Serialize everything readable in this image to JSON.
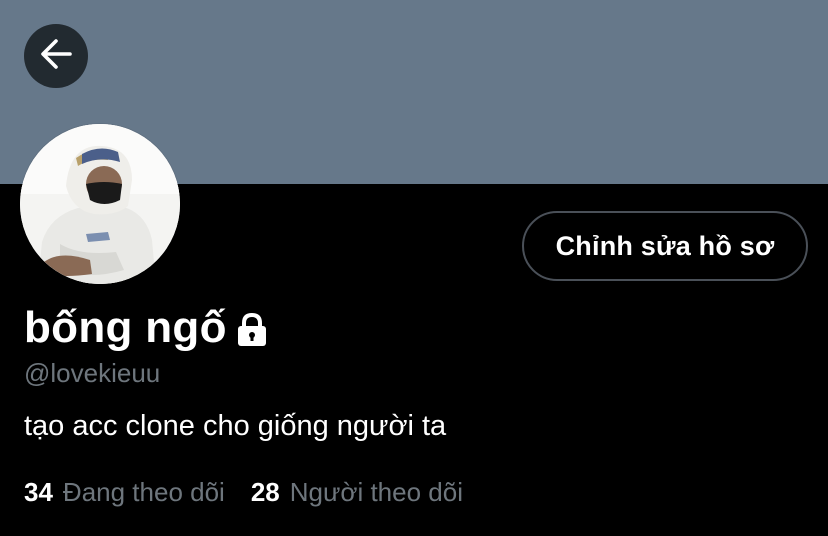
{
  "colors": {
    "banner": "#66788a",
    "background": "#000000",
    "secondary_text": "#6e767d",
    "button_border": "#4a5058"
  },
  "header": {
    "back_icon": "arrow-left-icon"
  },
  "profile": {
    "avatar_icon": "profile-avatar",
    "edit_button_label": "Chỉnh sửa hồ sơ",
    "display_name": "bống ngố",
    "protected_icon": "lock-icon",
    "handle": "@lovekieuu",
    "bio": "tạo acc clone cho giống người ta"
  },
  "stats": {
    "following_count": "34",
    "following_label": "Đang theo dõi",
    "followers_count": "28",
    "followers_label": "Người theo dõi"
  }
}
